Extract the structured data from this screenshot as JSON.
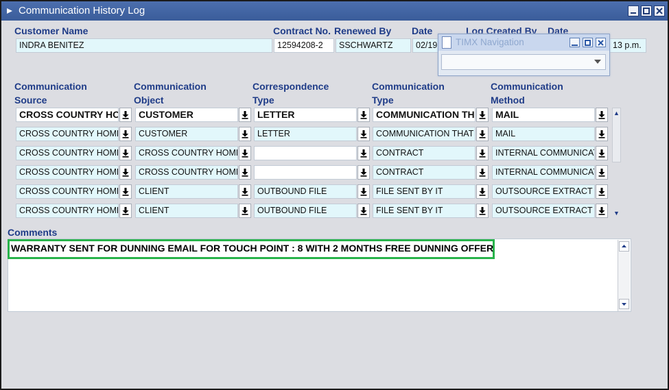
{
  "window": {
    "title": "Communication History Log"
  },
  "header_labels": {
    "customer_name": "Customer Name",
    "contract_no": "Contract No.",
    "renewed_by": "Renewed By",
    "date": "Date",
    "log_created_by": "Log Created By",
    "date2": "Date"
  },
  "header_values": {
    "customer_name": "INDRA BENITEZ",
    "contract_no": "12594208-2",
    "renewed_by": "SSCHWARTZ",
    "date": "02/19",
    "log_date_time": "13 p.m."
  },
  "column_headers": {
    "source": [
      "Communication",
      "Source"
    ],
    "object": [
      "Communication",
      "Object"
    ],
    "correspondence": [
      "Correspondence",
      "Type"
    ],
    "type": [
      "Communication",
      "Type"
    ],
    "method": [
      "Communication",
      "Method"
    ]
  },
  "rows": [
    {
      "source": "CROSS COUNTRY HO",
      "object": "CUSTOMER",
      "correspondence": "LETTER",
      "type": "COMMUNICATION TH",
      "method": "MAIL"
    },
    {
      "source": "CROSS COUNTRY HOME",
      "object": "CUSTOMER",
      "correspondence": "LETTER",
      "type": "COMMUNICATION THAT",
      "method": "MAIL"
    },
    {
      "source": "CROSS COUNTRY HOME",
      "object": "CROSS COUNTRY HOME",
      "correspondence": "",
      "type": "CONTRACT",
      "method": "INTERNAL COMMUNICAT"
    },
    {
      "source": "CROSS COUNTRY HOME",
      "object": "CROSS COUNTRY HOME",
      "correspondence": "",
      "type": "CONTRACT",
      "method": "INTERNAL COMMUNICAT"
    },
    {
      "source": "CROSS COUNTRY HOME",
      "object": "CLIENT",
      "correspondence": "OUTBOUND FILE",
      "type": "FILE SENT BY IT",
      "method": "OUTSOURCE EXTRACT I"
    },
    {
      "source": "CROSS COUNTRY HOME",
      "object": "CLIENT",
      "correspondence": "OUTBOUND FILE",
      "type": "FILE SENT BY IT",
      "method": "OUTSOURCE EXTRACT I"
    }
  ],
  "comments": {
    "label": "Comments",
    "text": "WARRANTY SENT FOR DUNNING EMAIL FOR TOUCH POINT :  8 WITH 2 MONTHS FREE DUNNING OFFER"
  },
  "popup": {
    "title": "TIMX Navigation",
    "selected": ""
  },
  "colors": {
    "title_bar": "#3f63a3",
    "label_text": "#1f3c88",
    "field_bg": "#e2f7fb",
    "window_bg": "#dcdde2",
    "highlight": "#28b34b"
  },
  "icons": {
    "dropdown": "down-arrow-to-line-icon",
    "minimize": "minimize-icon",
    "maximize": "maximize-icon",
    "close": "close-icon"
  }
}
